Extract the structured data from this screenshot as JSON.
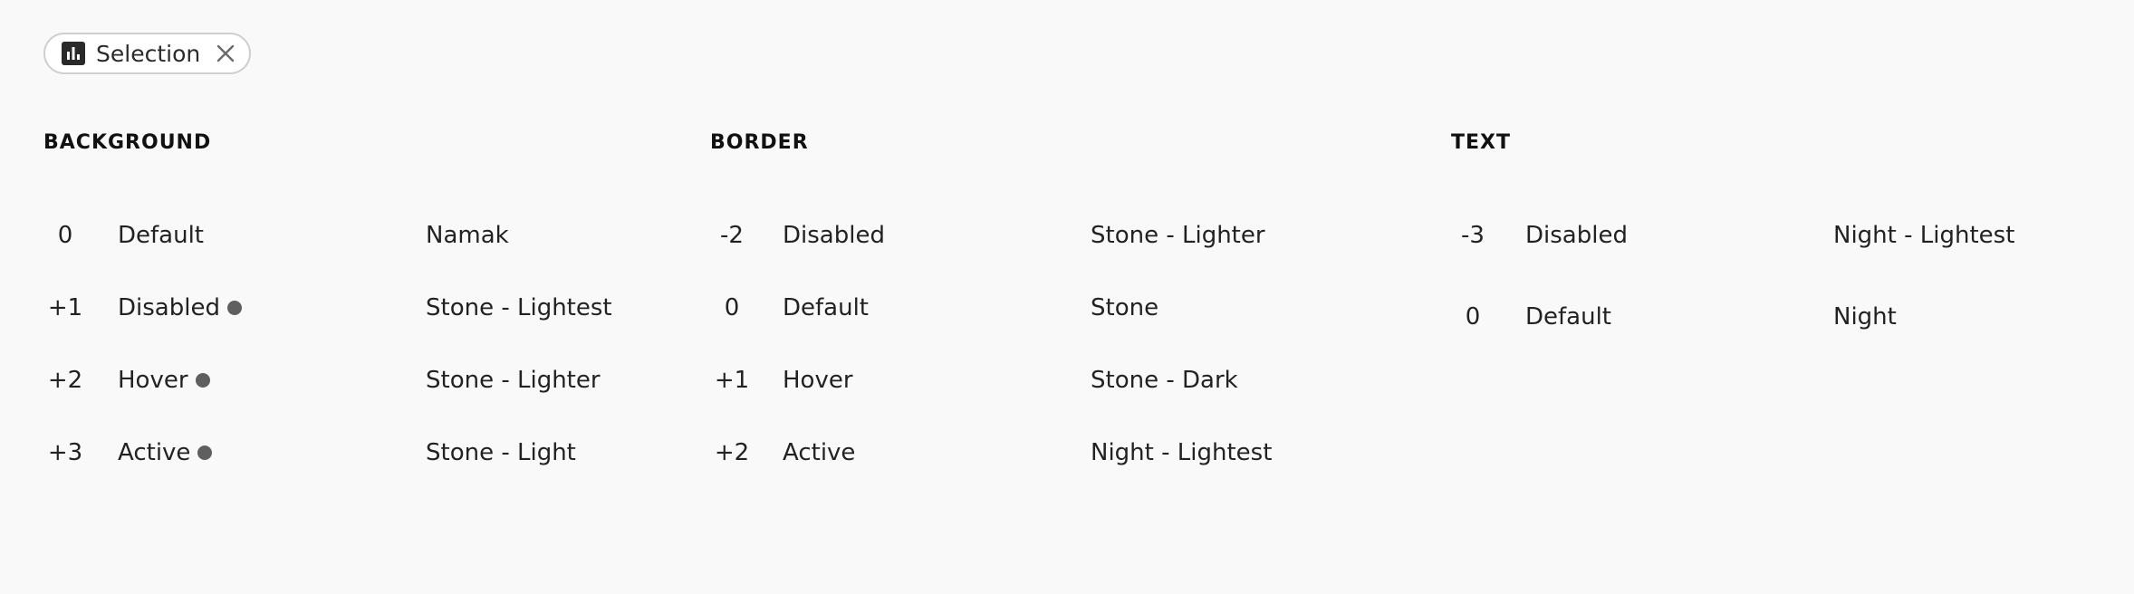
{
  "chip": {
    "label": "Selection",
    "icon": "bar-chart-icon",
    "close_icon": "close-icon"
  },
  "colors": {
    "background": "#f9f9f9",
    "text": "#1c1c1c",
    "dot": "#5f5f5f",
    "chip_border": "#cfcfcf"
  },
  "sections": {
    "background": {
      "title": "BACKGROUND",
      "rows": [
        {
          "index": "0",
          "state": "Default",
          "token": "Namak",
          "dot": false
        },
        {
          "index": "+1",
          "state": "Disabled",
          "token": "Stone - Lightest",
          "dot": true
        },
        {
          "index": "+2",
          "state": "Hover",
          "token": "Stone - Lighter",
          "dot": true
        },
        {
          "index": "+3",
          "state": "Active",
          "token": "Stone - Light",
          "dot": true
        }
      ]
    },
    "border": {
      "title": "BORDER",
      "rows": [
        {
          "index": "-2",
          "state": "Disabled",
          "token": "Stone - Lighter",
          "dot": false
        },
        {
          "index": "0",
          "state": "Default",
          "token": "Stone",
          "dot": false
        },
        {
          "index": "+1",
          "state": "Hover",
          "token": "Stone - Dark",
          "dot": false
        },
        {
          "index": "+2",
          "state": "Active",
          "token": "Night - Lightest",
          "dot": false
        }
      ]
    },
    "text": {
      "title": "TEXT",
      "rows": [
        {
          "index": "-3",
          "state": "Disabled",
          "token": "Night - Lightest",
          "dot": false
        },
        {
          "index": "0",
          "state": "Default",
          "token": "Night",
          "dot": false
        }
      ]
    }
  }
}
